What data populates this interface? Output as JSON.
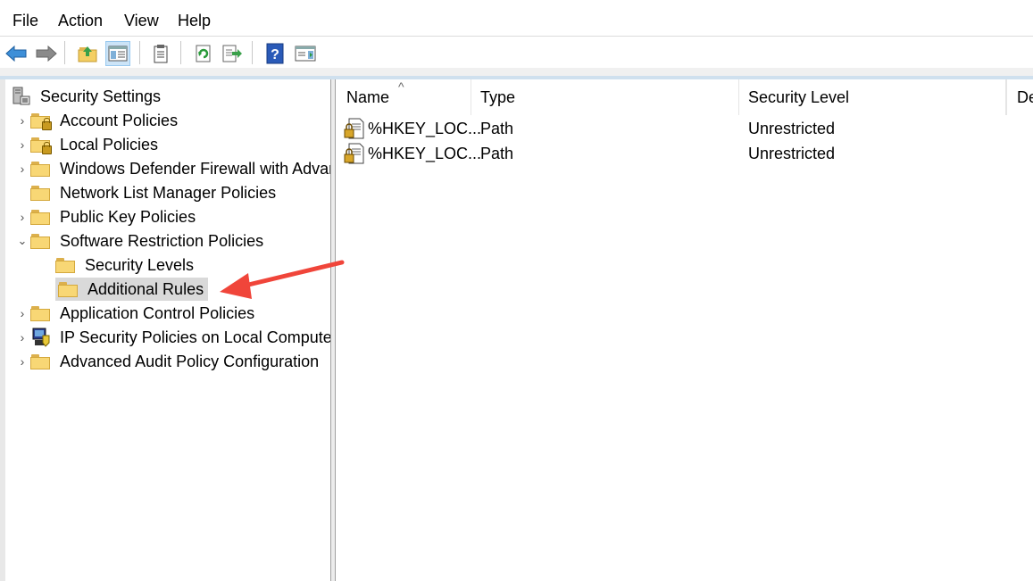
{
  "menu": {
    "file": "File",
    "action": "Action",
    "view": "View",
    "help": "Help"
  },
  "toolbar": {
    "icons": [
      "back-arrow-icon",
      "forward-arrow-icon",
      "up-folder-icon",
      "show-hide-tree-icon",
      "properties-icon",
      "refresh-icon",
      "export-list-icon",
      "help-icon",
      "show-action-pane-icon"
    ]
  },
  "tree": {
    "root": "Security Settings",
    "items": [
      {
        "label": "Account Policies"
      },
      {
        "label": "Local Policies"
      },
      {
        "label": "Windows Defender Firewall with Advar"
      },
      {
        "label": "Network List Manager Policies"
      },
      {
        "label": "Public Key Policies"
      },
      {
        "label": "Software Restriction Policies"
      },
      {
        "label": "Security Levels"
      },
      {
        "label": "Additional Rules"
      },
      {
        "label": "Application Control Policies"
      },
      {
        "label": "IP Security Policies on Local Computer"
      },
      {
        "label": "Advanced Audit Policy Configuration"
      }
    ]
  },
  "list": {
    "columns": [
      "Name",
      "Type",
      "Security Level",
      "De"
    ],
    "sort_indicator": "^",
    "rows": [
      {
        "name": "%HKEY_LOC...",
        "type": "Path",
        "level": "Unrestricted"
      },
      {
        "name": "%HKEY_LOC...",
        "type": "Path",
        "level": "Unrestricted"
      }
    ]
  },
  "colors": {
    "annotation_arrow": "#f0453a",
    "selection": "#d9d9d9"
  }
}
